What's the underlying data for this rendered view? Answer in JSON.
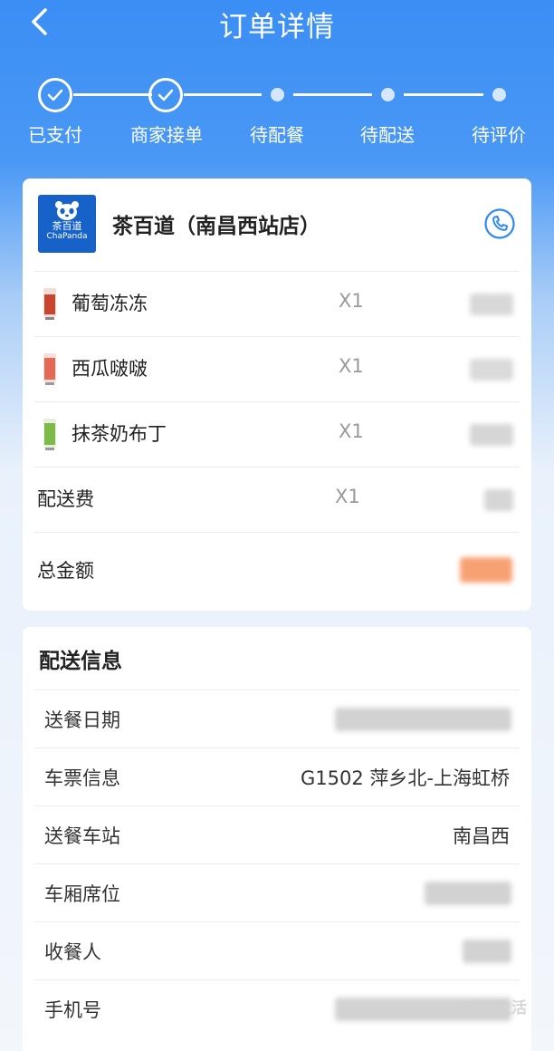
{
  "header": {
    "title": "订单详情"
  },
  "steps": [
    {
      "label": "已支付",
      "done": true
    },
    {
      "label": "商家接单",
      "done": true
    },
    {
      "label": "待配餐",
      "done": false
    },
    {
      "label": "待配送",
      "done": false
    },
    {
      "label": "待评价",
      "done": false
    }
  ],
  "store": {
    "name": "茶百道（南昌西站店）",
    "logo_cn": "茶百道",
    "logo_en": "ChaPanda"
  },
  "items": [
    {
      "name": "葡萄冻冻",
      "qty": "X1",
      "thumb_color": "#c9452e"
    },
    {
      "name": "西瓜啵啵",
      "qty": "X1",
      "thumb_color": "#e56a55"
    },
    {
      "name": "抹茶奶布丁",
      "qty": "X1",
      "thumb_color": "#7dbb48"
    }
  ],
  "delivery_fee": {
    "label": "配送费",
    "qty": "X1"
  },
  "total": {
    "label": "总金额"
  },
  "delivery_info": {
    "title": "配送信息",
    "rows": [
      {
        "label": "送餐日期",
        "value": ""
      },
      {
        "label": "车票信息",
        "value": "G1502 萍乡北-上海虹桥"
      },
      {
        "label": "送餐车站",
        "value": "南昌西"
      },
      {
        "label": "车厢席位",
        "value": ""
      },
      {
        "label": "收餐人",
        "value": ""
      },
      {
        "label": "手机号",
        "value": ""
      }
    ]
  },
  "colors": {
    "primary": "#3a8ef4",
    "accent_total": "#f7a173",
    "icon_blue": "#2f8af0"
  },
  "watermark": "咩叫生活"
}
